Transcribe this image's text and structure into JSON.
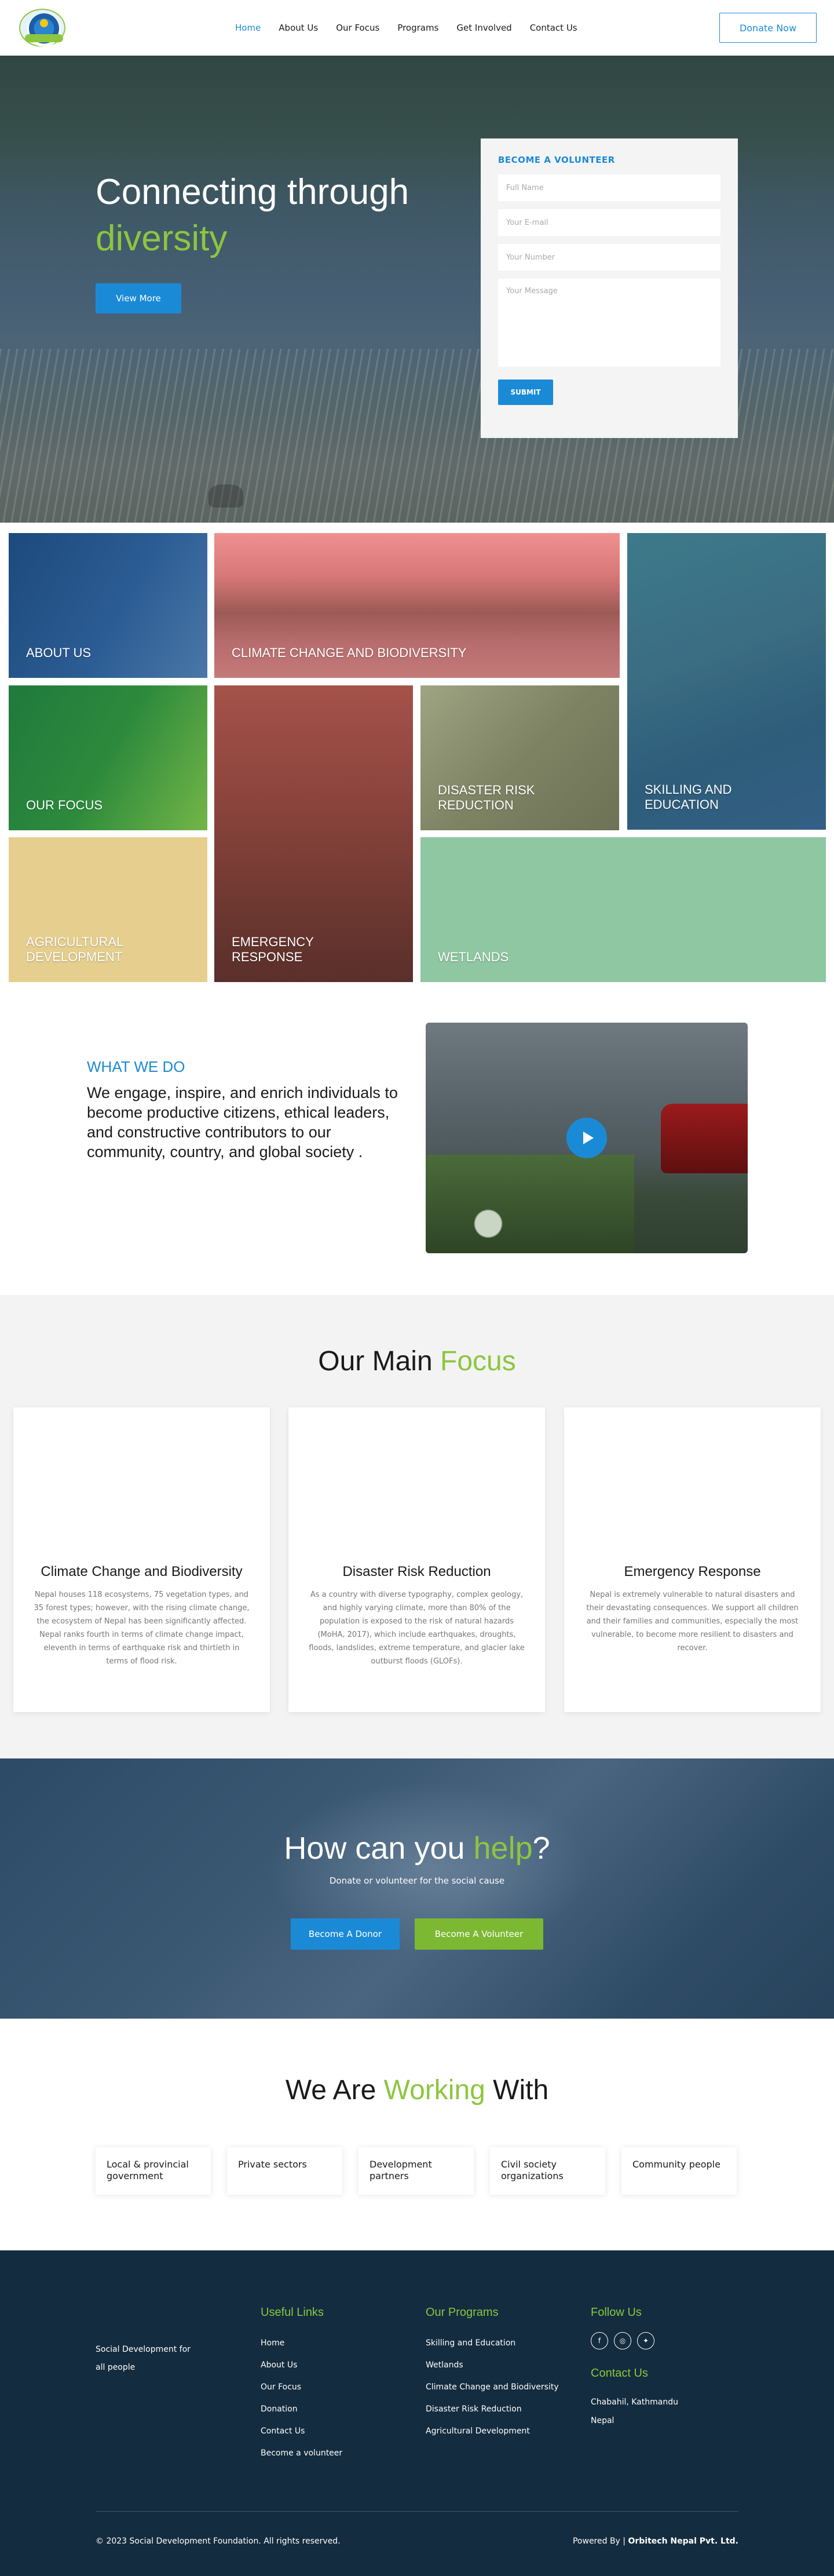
{
  "header": {
    "nav": [
      "Home",
      "About Us",
      "Our Focus",
      "Programs",
      "Get Involved",
      "Contact Us"
    ],
    "donate": "Donate Now"
  },
  "hero": {
    "title_line1": "Connecting through",
    "title_line2": "diversity",
    "cta": "View More",
    "volunteer": {
      "heading": "BECOME A VOLUNTEER",
      "full_name_placeholder": "Full Name",
      "email_placeholder": "Your E-mail",
      "number_placeholder": "Your Number",
      "message_placeholder": "Your Message",
      "submit": "SUBMIT"
    }
  },
  "tiles": {
    "about": "ABOUT US",
    "climate": "CLIMATE CHANGE AND BIODIVERSITY",
    "skilling": "SKILLING AND EDUCATION",
    "focus": "OUR FOCUS",
    "emergency": "EMERGENCY RESPONSE",
    "disaster": "DISASTER RISK REDUCTION",
    "agri": "AGRICULTURAL DEVELOPMENT",
    "wetlands": "WETLANDS"
  },
  "what_we_do": {
    "kicker": "WHAT WE DO",
    "body": "We engage, inspire, and enrich individuals to become productive citizens, ethical leaders, and constructive contributors to our community, country, and global society ."
  },
  "main_focus": {
    "title_a": "Our Main ",
    "title_b": "Focus",
    "cards": [
      {
        "title": "Climate Change and Biodiversity",
        "text": "Nepal houses 118 ecosystems, 75 vegetation types, and 35 forest types; however, with the rising climate change, the ecosystem of Nepal has been significantly affected. Nepal ranks fourth in terms of climate change impact, eleventh in terms of earthquake risk and thirtieth in terms of flood risk."
      },
      {
        "title": "Disaster Risk Reduction",
        "text": "As a country with diverse typography, complex geology, and highly varying climate, more than 80% of the population is exposed to the risk of natural hazards (MoHA, 2017), which include earthquakes, droughts, floods, landslides, extreme temperature, and glacier lake outburst floods (GLOFs)."
      },
      {
        "title": "Emergency Response",
        "text": "Nepal is extremely vulnerable to natural disasters and their devastating consequences. We support all children and their families and communities, especially the most vulnerable, to become more resilient to disasters and recover."
      }
    ]
  },
  "help": {
    "title_a": "How can you ",
    "title_b": "help",
    "title_c": "?",
    "sub": "Donate or volunteer for the social cause",
    "donor": "Become A Donor",
    "volunteer": "Become A Volunteer"
  },
  "working": {
    "title_a": "We Are ",
    "title_b": "Working",
    "title_c": " With",
    "partners": [
      "Local & provincial government",
      "Private sectors",
      "Development partners",
      "Civil society organizations",
      "Community people"
    ]
  },
  "footer": {
    "tagline": "Social Development for all people",
    "useful_heading": "Useful Links",
    "useful": [
      "Home",
      "About Us",
      "Our Focus",
      "Donation",
      "Contact Us",
      "Become a volunteer"
    ],
    "programs_heading": "Our Programs",
    "programs": [
      "Skilling and Education",
      "Wetlands",
      "Climate Change and Biodiversity",
      "Disaster Risk Reduction",
      "Agricultural Development"
    ],
    "follow_heading": "Follow Us",
    "contact_heading": "Contact Us",
    "address": "Chabahil, Kathmandu Nepal",
    "copyright": "© 2023 Social Development Foundation. All rights reserved.",
    "powered_prefix": "Powered By | ",
    "powered_by": "Orbitech Nepal Pvt. Ltd."
  },
  "colors": {
    "primary_blue": "#1b8ad6",
    "accent_green": "#8cc63f",
    "footer_bg": "#142c3f"
  },
  "icons": [
    "facebook-icon",
    "instagram-icon",
    "twitter-icon",
    "play-icon"
  ]
}
